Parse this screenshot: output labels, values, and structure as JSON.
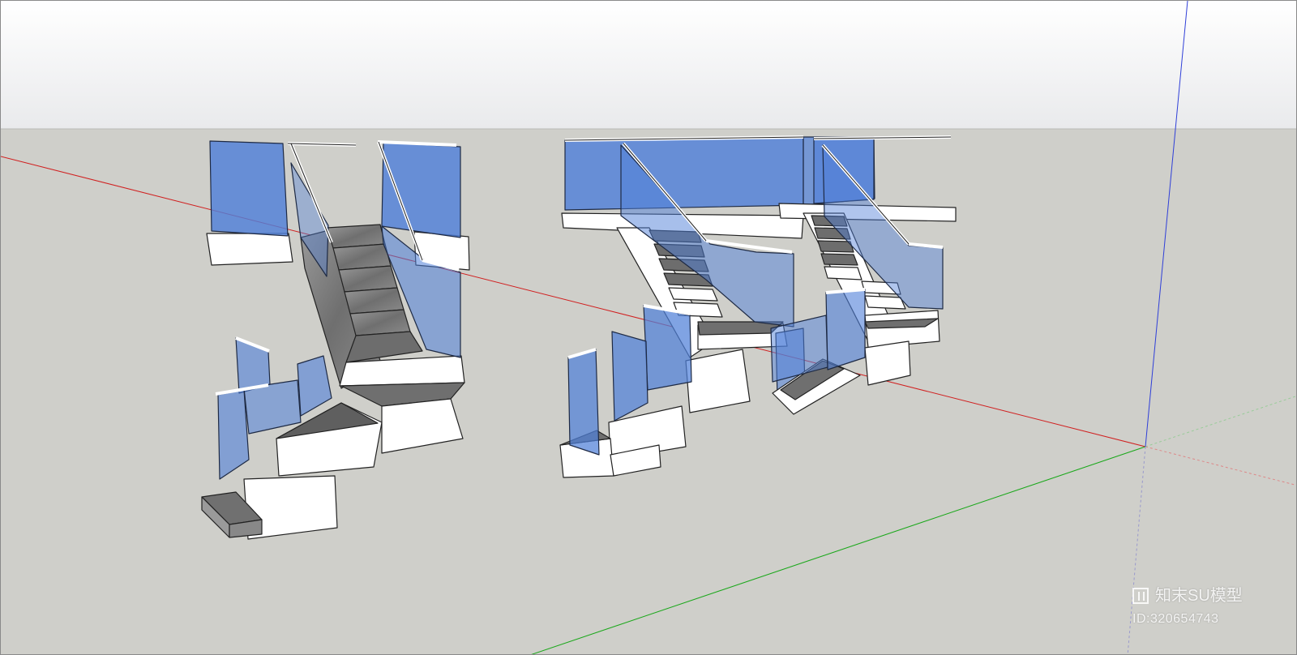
{
  "scene": {
    "sky_color": "#f0f1f3",
    "ground_color": "#cfcfca",
    "axis_colors": {
      "red": "#d02020",
      "green": "#1ba81b",
      "blue": "#2f3fd8"
    },
    "glass_color": "#5b86d6",
    "tread_color": "#7c7c7c",
    "structure_color": "#ffffff"
  },
  "watermark": {
    "logo_icon": "zhimo-logo-icon",
    "brand": "知末SU模型",
    "id": "ID:320654743"
  }
}
